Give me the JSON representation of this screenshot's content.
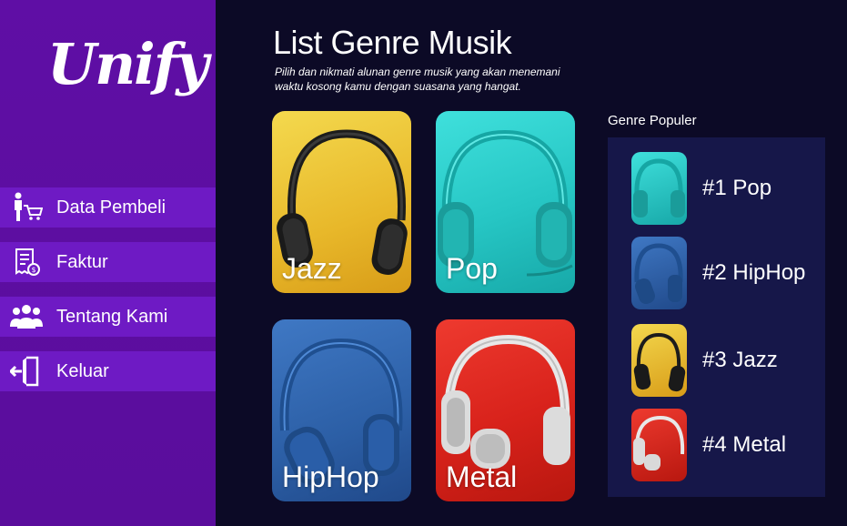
{
  "brand": {
    "logo_text": "Unify"
  },
  "sidebar": {
    "items": [
      {
        "label": "Data Pembeli",
        "icon": "customer-cart-icon"
      },
      {
        "label": "Faktur",
        "icon": "invoice-icon"
      },
      {
        "label": "Tentang Kami",
        "icon": "team-icon"
      },
      {
        "label": "Keluar",
        "icon": "logout-icon"
      }
    ]
  },
  "main": {
    "title": "List Genre Musik",
    "subtitle": "Pilih dan nikmati alunan genre musik yang akan menemani waktu kosong kamu dengan suasana yang hangat.",
    "genres": [
      {
        "name": "Jazz",
        "color": "#e8b82a"
      },
      {
        "name": "Pop",
        "color": "#26c6c4"
      },
      {
        "name": "HipHop",
        "color": "#2c5fa6"
      },
      {
        "name": "Metal",
        "color": "#d8221b"
      }
    ]
  },
  "popular": {
    "title": "Genre Populer",
    "items": [
      {
        "label": "#1 Pop",
        "color": "#26c6c4"
      },
      {
        "label": "#2 HipHop",
        "color": "#2c5fa6"
      },
      {
        "label": "#3 Jazz",
        "color": "#e8b82a"
      },
      {
        "label": "#4 Metal",
        "color": "#d8221b"
      }
    ]
  },
  "colors": {
    "sidebar": "#5f0ea5",
    "menu_item": "#6e1ac4",
    "background": "#0c0a26",
    "panel": "#161749"
  }
}
